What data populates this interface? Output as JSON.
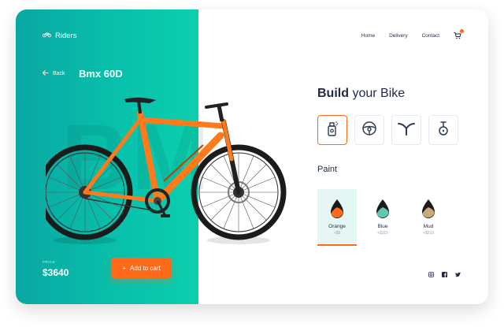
{
  "brand": {
    "name": "Riders",
    "icon": "bicycle-icon"
  },
  "nav": {
    "links": [
      "Home",
      "Delivery",
      "Contact"
    ],
    "cart_icon": "cart-icon"
  },
  "product": {
    "back_label": "Back",
    "model": "Bmx 60D",
    "watermark": "BM",
    "price_label": "PRICE",
    "price": "$3640",
    "add_to_cart": "Add to cart"
  },
  "builder": {
    "title_bold": "Build",
    "title_rest": " your Bike",
    "parts": [
      {
        "icon": "spray-can-icon",
        "selected": true
      },
      {
        "icon": "steering-wheel-icon",
        "selected": false
      },
      {
        "icon": "handlebar-icon",
        "selected": false
      },
      {
        "icon": "saddle-icon",
        "selected": false
      }
    ]
  },
  "paint": {
    "title": "Paint",
    "options": [
      {
        "name": "Orange",
        "price": "+$0",
        "color": "#ff6a1a",
        "selected": true
      },
      {
        "name": "Blue",
        "price": "+$110",
        "color": "#5fc9b0",
        "selected": false
      },
      {
        "name": "Mud",
        "price": "+$210",
        "color": "#c9a979",
        "selected": false
      }
    ]
  },
  "social": [
    "instagram-icon",
    "facebook-icon",
    "twitter-icon"
  ],
  "colors": {
    "teal_start": "#0aa7a2",
    "teal_end": "#0ccfae",
    "accent": "#ff6a1a",
    "text_dark": "#1f2a44"
  }
}
